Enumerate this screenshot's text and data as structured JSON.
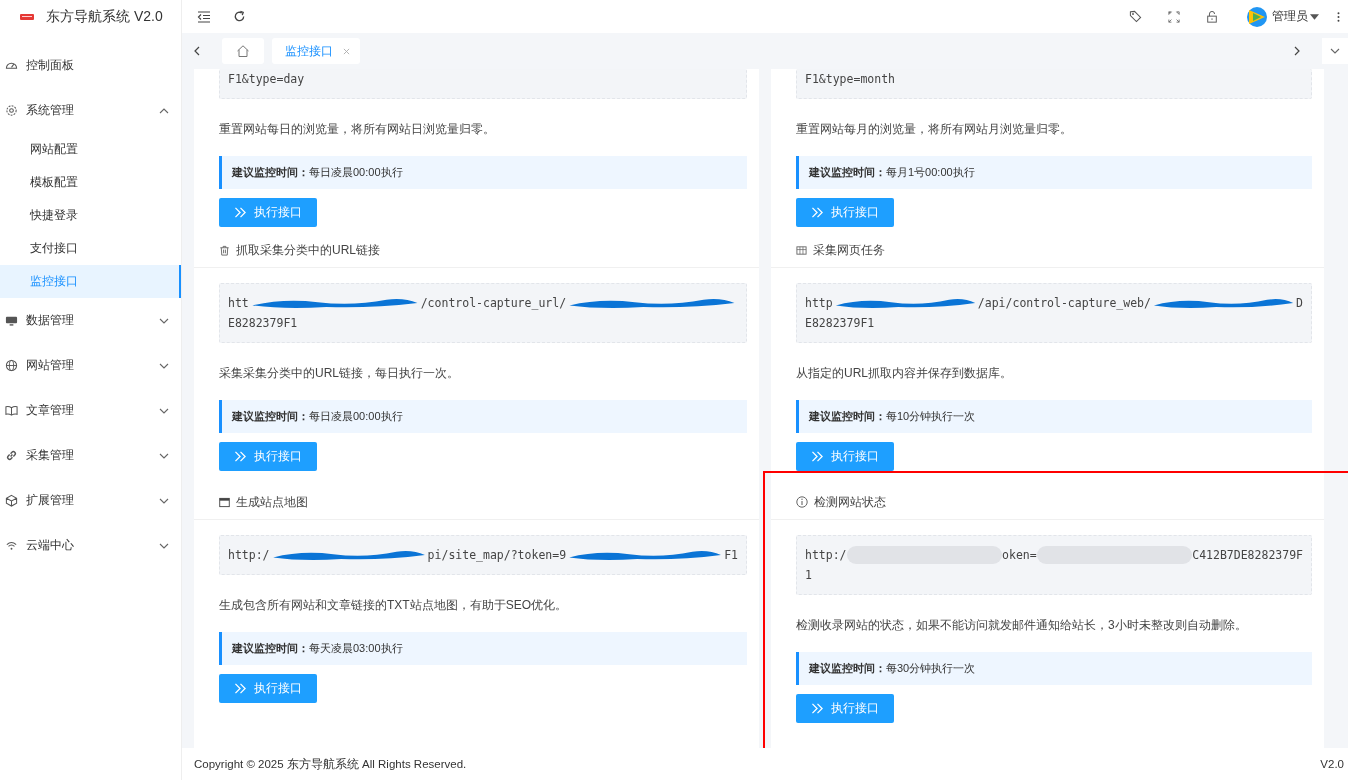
{
  "header": {
    "title": "东方导航系统 V2.0",
    "user": "管理员"
  },
  "sidebar": {
    "items": [
      {
        "kind": "link",
        "label": "控制面板",
        "selected": false
      },
      {
        "kind": "group",
        "label": "系统管理",
        "expanded": true,
        "selected": false,
        "children": [
          {
            "label": "网站配置",
            "selected": false
          },
          {
            "label": "模板配置",
            "selected": false
          },
          {
            "label": "快捷登录",
            "selected": false
          },
          {
            "label": "支付接口",
            "selected": false
          },
          {
            "label": "监控接口",
            "selected": true
          }
        ]
      },
      {
        "kind": "group",
        "label": "数据管理",
        "expanded": false,
        "selected": false
      },
      {
        "kind": "group",
        "label": "网站管理",
        "expanded": false,
        "selected": false
      },
      {
        "kind": "group",
        "label": "文章管理",
        "expanded": false,
        "selected": false
      },
      {
        "kind": "group",
        "label": "采集管理",
        "expanded": false,
        "selected": false
      },
      {
        "kind": "group",
        "label": "扩展管理",
        "expanded": false,
        "selected": false
      },
      {
        "kind": "group",
        "label": "云端中心",
        "expanded": false,
        "selected": false
      }
    ]
  },
  "tabs": [
    {
      "kind": "home",
      "selected": false
    },
    {
      "kind": "page",
      "label": "监控接口",
      "selected": true
    }
  ],
  "sections": [
    {
      "url_lines": [
        [
          {
            "kind": "text",
            "text": "F1&type=day"
          }
        ]
      ],
      "description": "重置网站每日的浏览量，将所有网站日浏览量归零。",
      "tip": {
        "label": "建议监控时间：",
        "text": "每日凌晨00:00执行"
      },
      "button": "执行接口",
      "highlighted": false
    },
    {
      "url_lines": [
        [
          {
            "kind": "text",
            "text": "F1&type=month"
          }
        ]
      ],
      "description": "重置网站每月的浏览量，将所有网站月浏览量归零。",
      "tip": {
        "label": "建议监控时间：",
        "text": "每月1号00:00执行"
      },
      "button": "执行接口",
      "highlighted": false
    },
    {
      "title": "抓取采集分类中的URL链接",
      "url_lines": [
        [
          {
            "kind": "text",
            "text": "htt"
          },
          {
            "kind": "scribble"
          },
          {
            "kind": "text",
            "text": "/control-capture_url/"
          },
          {
            "kind": "scribble"
          }
        ],
        [
          {
            "kind": "text",
            "text": "E8282379F1"
          }
        ]
      ],
      "description": "采集采集分类中的URL链接，每日执行一次。",
      "tip": {
        "label": "建议监控时间：",
        "text": "每日凌晨00:00执行"
      },
      "button": "执行接口",
      "highlighted": false
    },
    {
      "title": "采集网页任务",
      "url_lines": [
        [
          {
            "kind": "text",
            "text": "http"
          },
          {
            "kind": "scribble"
          },
          {
            "kind": "text",
            "text": "/api/control-capture_web/"
          },
          {
            "kind": "scribble"
          },
          {
            "kind": "text",
            "text": "D"
          }
        ],
        [
          {
            "kind": "text",
            "text": "E8282379F1"
          }
        ]
      ],
      "description": "从指定的URL抓取内容并保存到数据库。",
      "tip": {
        "label": "建议监控时间：",
        "text": "每10分钟执行一次"
      },
      "button": "执行接口",
      "highlighted": false
    },
    {
      "title": "生成站点地图",
      "url_lines": [
        [
          {
            "kind": "text",
            "text": "http:/"
          },
          {
            "kind": "scribble"
          },
          {
            "kind": "text",
            "text": "pi/site_map/?token=9"
          },
          {
            "kind": "scribble"
          },
          {
            "kind": "text",
            "text": "F1"
          }
        ]
      ],
      "description": "生成包含所有网站和文章链接的TXT站点地图，有助于SEO优化。",
      "tip": {
        "label": "建议监控时间：",
        "text": "每天凌晨03:00执行"
      },
      "button": "执行接口",
      "highlighted": false
    },
    {
      "title": "检测网站状态",
      "url_lines": [
        [
          {
            "kind": "text",
            "text": "http:/"
          },
          {
            "kind": "blur"
          },
          {
            "kind": "text",
            "text": "oken="
          },
          {
            "kind": "blur"
          },
          {
            "kind": "text",
            "text": "C412B7DE8282379F"
          }
        ],
        [
          {
            "kind": "text",
            "text": "1"
          }
        ]
      ],
      "description": "检测收录网站的状态，如果不能访问就发邮件通知给站长，3小时未整改则自动删除。",
      "tip": {
        "label": "建议监控时间：",
        "text": "每30分钟执行一次"
      },
      "button": "执行接口",
      "highlighted": true
    }
  ],
  "footer": {
    "copyright": "Copyright © 2025 东方导航系统 All Rights Reserved.",
    "version": "V2.0"
  }
}
